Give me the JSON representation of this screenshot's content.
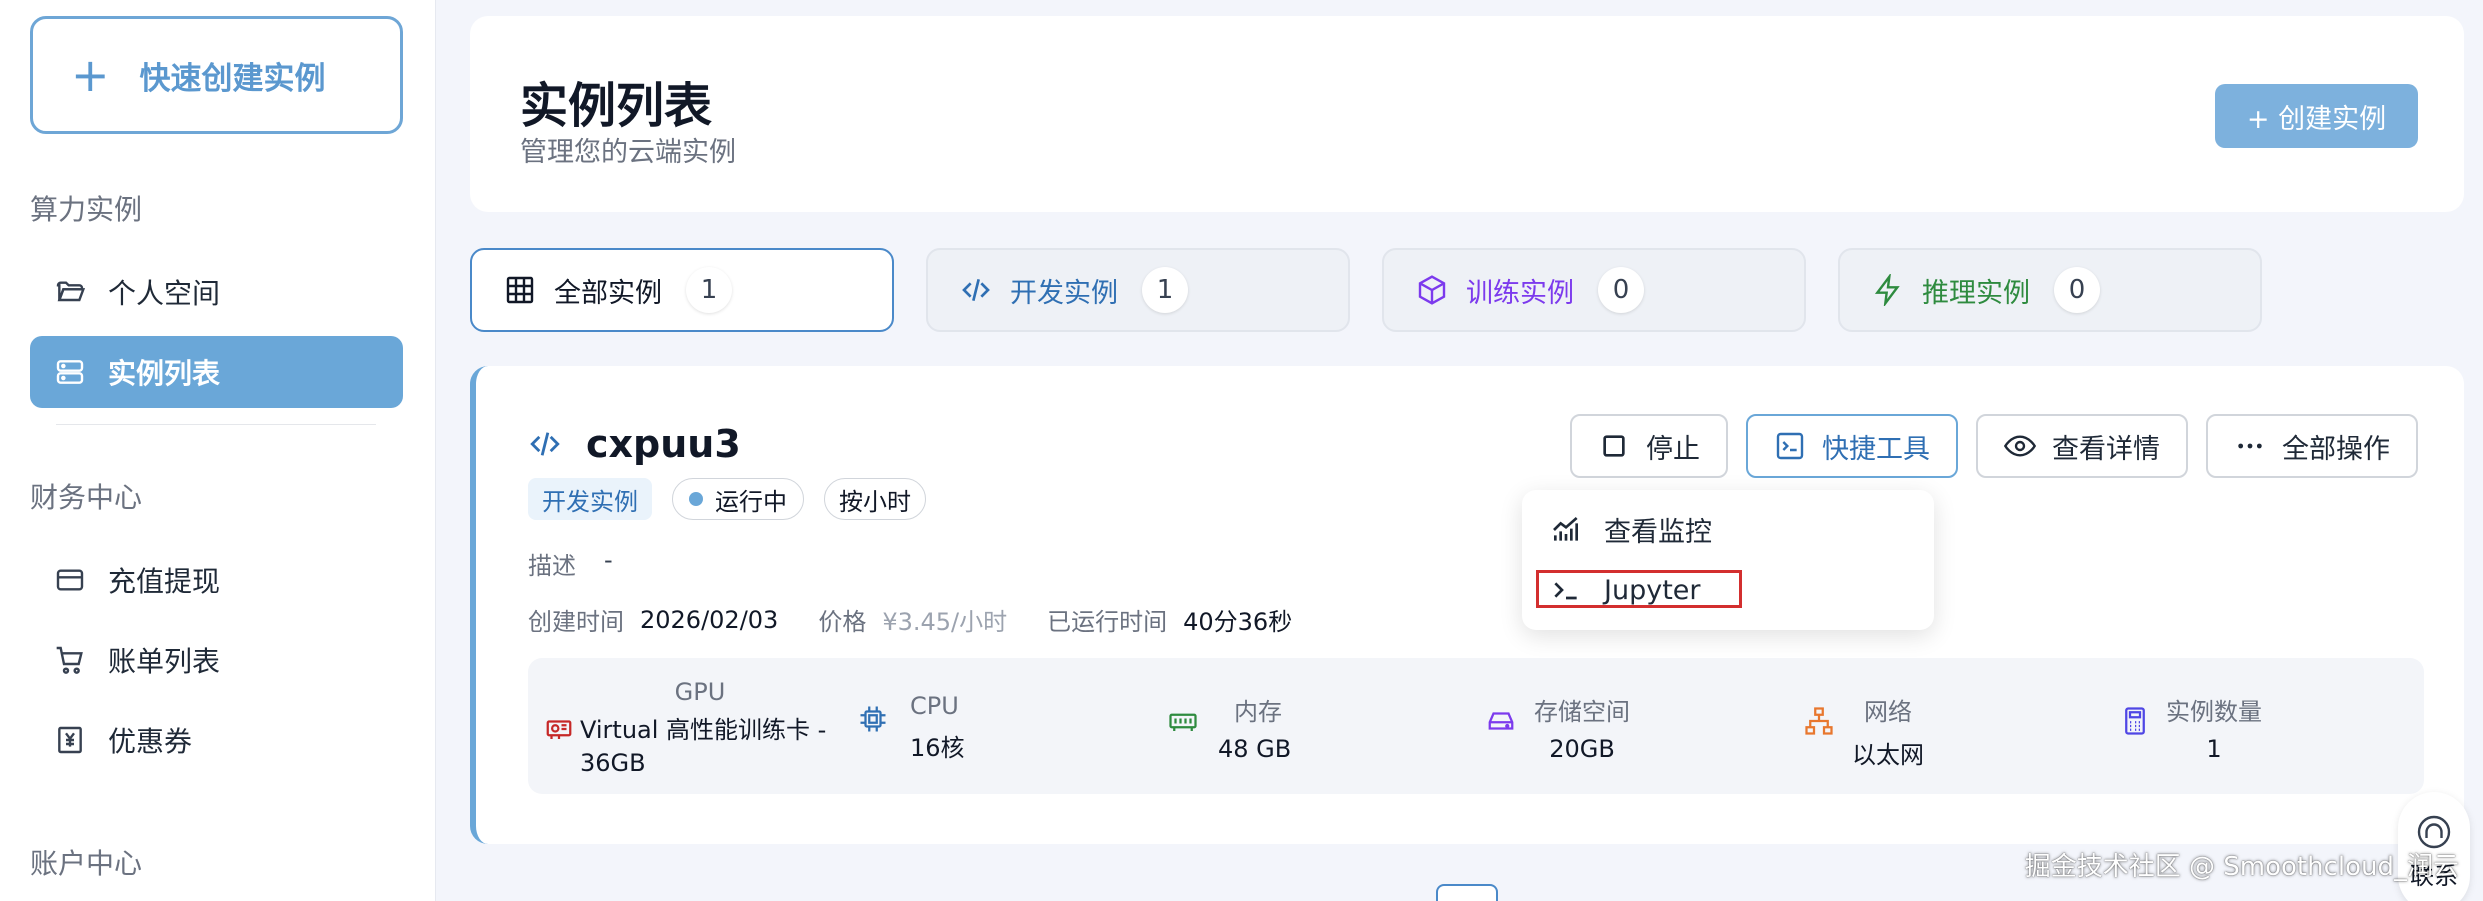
{
  "sidebar": {
    "quick_create_label": "快速创建实例",
    "section_compute": "算力实例",
    "item_personal": "个人空间",
    "item_instances": "实例列表",
    "section_finance": "财务中心",
    "item_recharge": "充值提现",
    "item_bills": "账单列表",
    "item_coupons": "优惠券",
    "section_account": "账户中心"
  },
  "header": {
    "title": "实例列表",
    "subtitle": "管理您的云端实例",
    "create_button": "+ 创建实例"
  },
  "tabs": [
    {
      "label": "全部实例",
      "count": "1"
    },
    {
      "label": "开发实例",
      "count": "1"
    },
    {
      "label": "训练实例",
      "count": "0"
    },
    {
      "label": "推理实例",
      "count": "0"
    }
  ],
  "instance": {
    "name": "cxpuu3",
    "type_badge": "开发实例",
    "status": "运行中",
    "billing": "按小时",
    "desc_label": "描述",
    "desc_value": "-",
    "created_label": "创建时间",
    "created_value": "2026/02/03",
    "price_label": "价格",
    "price_value": "¥3.45/小时",
    "runtime_label": "已运行时间",
    "runtime_value": "40分36秒",
    "actions": {
      "stop": "停止",
      "tools": "快捷工具",
      "details": "查看详情",
      "all": "全部操作"
    },
    "dropdown": {
      "monitor": "查看监控",
      "jupyter": "Jupyter"
    },
    "specs": {
      "gpu_label": "GPU",
      "gpu_value_1": "Virtual 高性能训练卡 -",
      "gpu_value_2": "36GB",
      "cpu_label": "CPU",
      "cpu_value": "16核",
      "mem_label": "内存",
      "mem_value": "48 GB",
      "storage_label": "存储空间",
      "storage_value": "20GB",
      "net_label": "网络",
      "net_value": "以太网",
      "count_label": "实例数量",
      "count_value": "1"
    }
  },
  "contact_label": "联系",
  "watermark": "掘金技术社区 @ Smoothcloud_润云",
  "colors": {
    "accent": "#6aa7d8",
    "dev": "#2f6fb3",
    "train": "#7c3aed",
    "infer": "#2e8b3f",
    "highlight": "#d32f2f"
  }
}
